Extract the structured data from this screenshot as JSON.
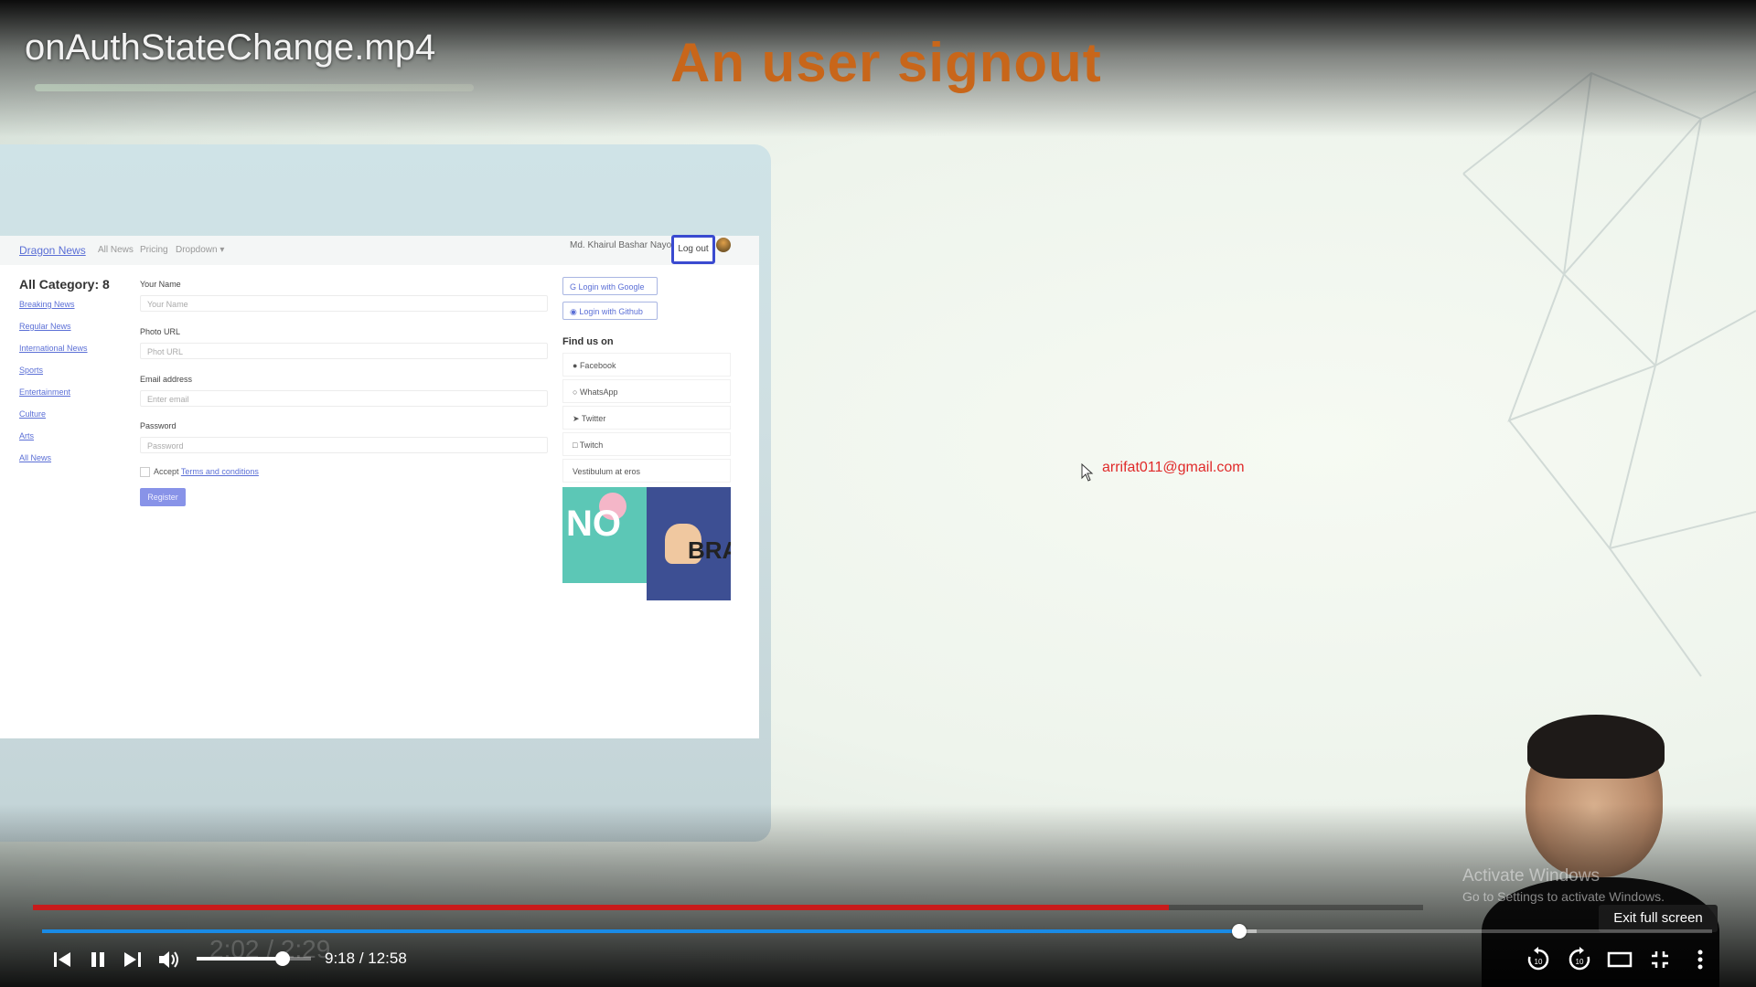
{
  "video": {
    "title": "onAuthStateChange.mp4",
    "slide_heading": "An user signout"
  },
  "embedded_page": {
    "brand": "Dragon News",
    "nav_links": [
      "All News",
      "Pricing",
      "Dropdown ▾"
    ],
    "user_name": "Md. Khairul Bashar Nayon",
    "logout_label": "Log out",
    "category_title": "All Category: 8",
    "categories": [
      "Breaking News",
      "Regular News",
      "International News",
      "Sports",
      "Entertainment",
      "Culture",
      "Arts",
      "All News"
    ],
    "form": {
      "name_label": "Your Name",
      "name_placeholder": "Your Name",
      "photo_label": "Photo URL",
      "photo_placeholder": "Phot URL",
      "email_label": "Email address",
      "email_placeholder": "Enter email",
      "password_label": "Password",
      "password_placeholder": "Password",
      "accept_prefix": "Accept",
      "terms_link": "Terms and conditions",
      "register_label": "Register"
    },
    "login_google": "Login with Google",
    "login_github": "Login with Github",
    "find_us_title": "Find us on",
    "find_us_items": [
      "Facebook",
      "WhatsApp",
      "Twitter",
      "Twitch",
      "Vestibulum at eros"
    ],
    "ad_text_left": "NO",
    "ad_text_right": "BRA"
  },
  "console_output": "arrifat011@gmail.com",
  "watermark": {
    "line1": "Activate Windows",
    "line2": "Go to Settings to activate Windows."
  },
  "player": {
    "current_time": "9:18",
    "duration": "12:58",
    "time_separator": " / ",
    "progress": 0.717,
    "buffered": 0.727,
    "volume": 0.75,
    "inner_video_progress": 0.817,
    "inner_video_time": "2:02 / 2:29",
    "tooltip": "Exit full screen",
    "accent_color": "#1a8be6",
    "icons": [
      "previous-icon",
      "pause-icon",
      "next-icon",
      "volume-icon",
      "rewind-10-icon",
      "forward-10-icon",
      "theater-mode-icon",
      "exit-fullscreen-icon",
      "more-options-icon"
    ]
  }
}
